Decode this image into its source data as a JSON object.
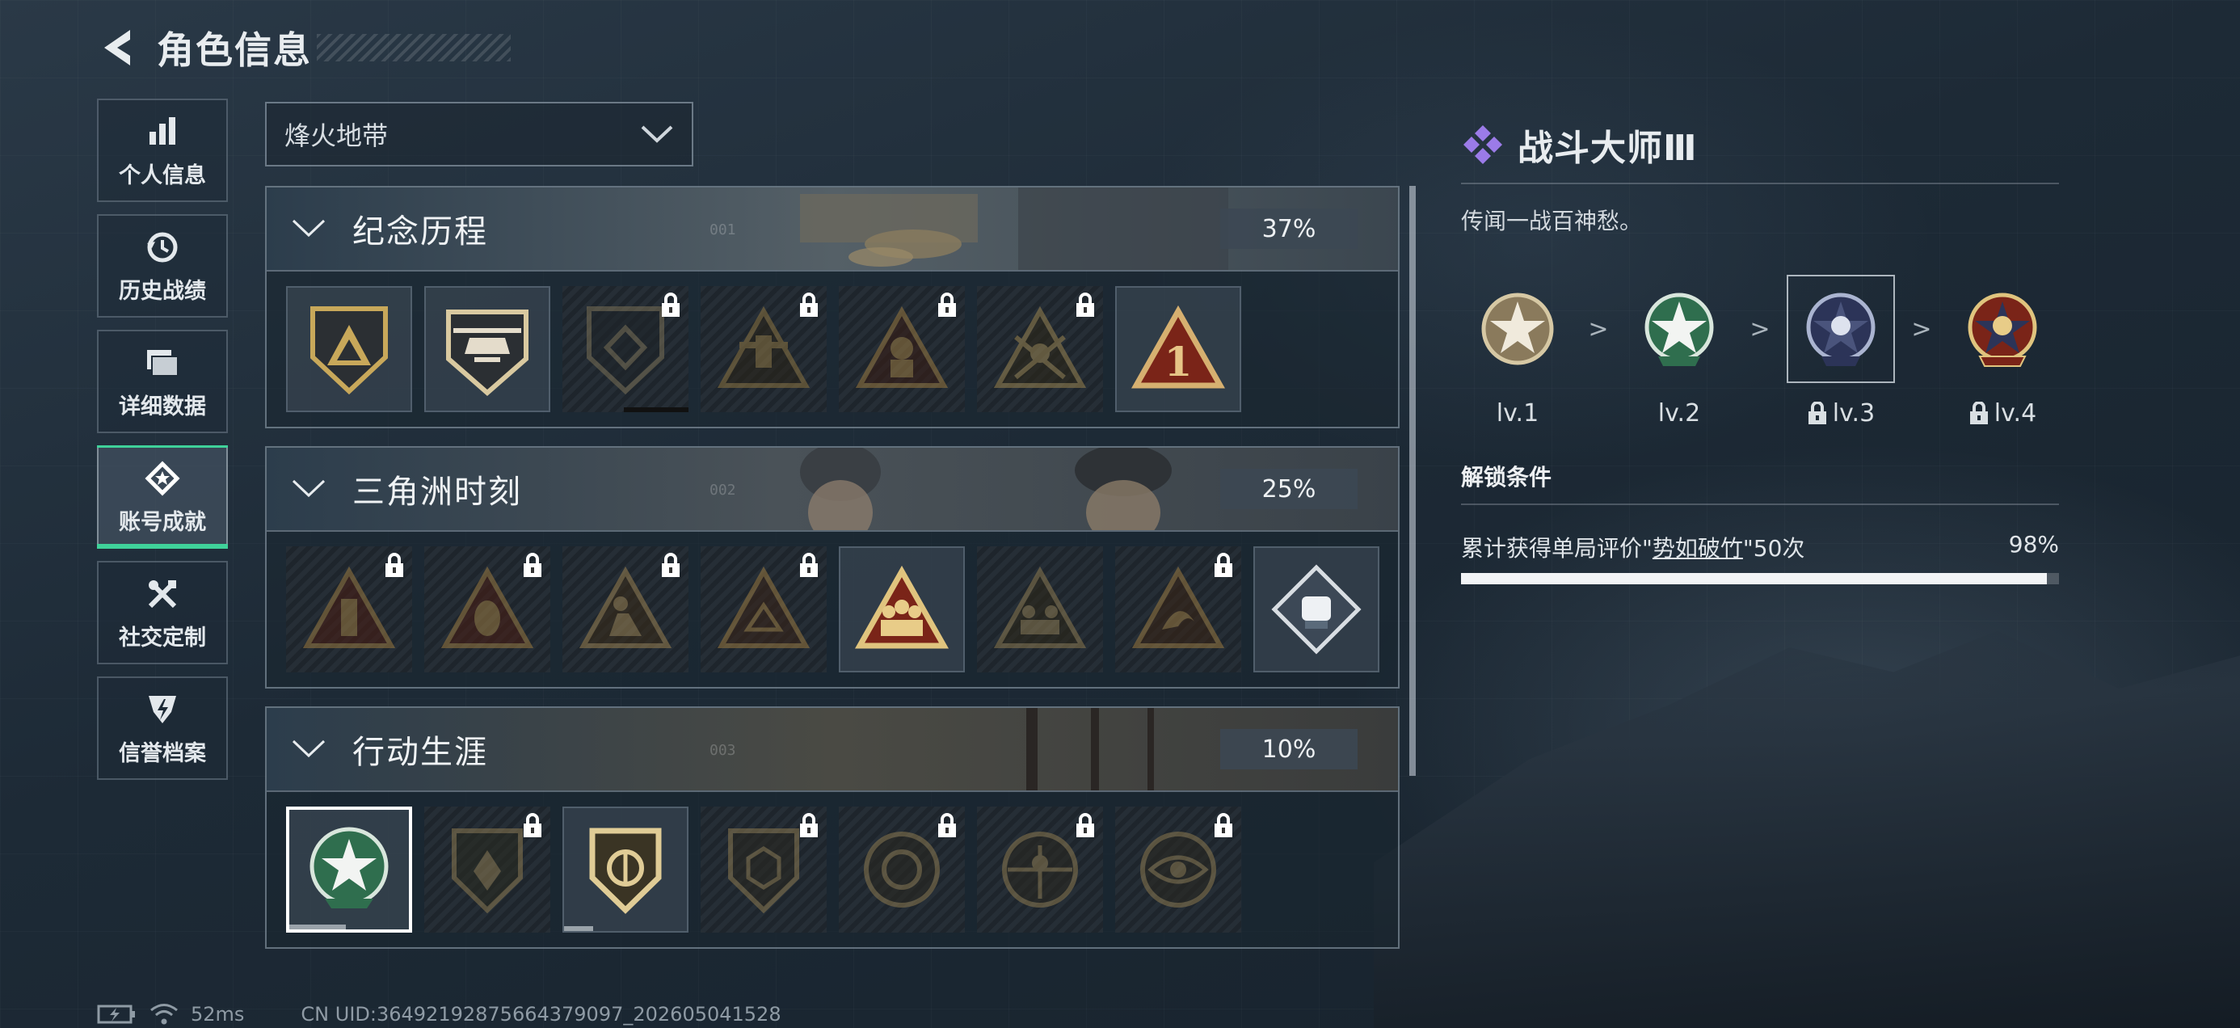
{
  "header": {
    "title": "角色信息"
  },
  "sidebar": {
    "items": [
      {
        "label": "个人信息",
        "icon": "bar-chart-icon"
      },
      {
        "label": "历史战绩",
        "icon": "history-icon"
      },
      {
        "label": "详细数据",
        "icon": "folder-icon"
      },
      {
        "label": "账号成就",
        "icon": "achievement-icon",
        "active": true
      },
      {
        "label": "社交定制",
        "icon": "tools-icon"
      },
      {
        "label": "信誉档案",
        "icon": "reputation-icon"
      }
    ]
  },
  "mode_select": {
    "value": "烽火地带"
  },
  "sections": [
    {
      "title": "纪念历程",
      "number": "001",
      "percent": "37%"
    },
    {
      "title": "三角洲时刻",
      "number": "002",
      "percent": "25%"
    },
    {
      "title": "行动生涯",
      "number": "003",
      "percent": "10%"
    }
  ],
  "detail": {
    "title": "战斗大师Ⅲ",
    "description": "传闻一战百神愁。",
    "levels": [
      {
        "label": "lv.1",
        "locked": false
      },
      {
        "label": "lv.2",
        "locked": false
      },
      {
        "label": "lv.3",
        "locked": true
      },
      {
        "label": "lv.4",
        "locked": true
      }
    ],
    "separator": ">",
    "unlock_title": "解锁条件",
    "condition_prefix": "累计获得单局评价\"",
    "condition_link": "势如破竹",
    "condition_suffix": "\"50次",
    "condition_percent": "98%",
    "condition_progress": 0.98
  },
  "footer": {
    "ping": "52ms",
    "uid": "CN UID:36492192875664379097_202605041528"
  },
  "colors": {
    "accent_green": "#3fd29a",
    "gold": "#c8a85a",
    "purple": "#9b7be8"
  }
}
